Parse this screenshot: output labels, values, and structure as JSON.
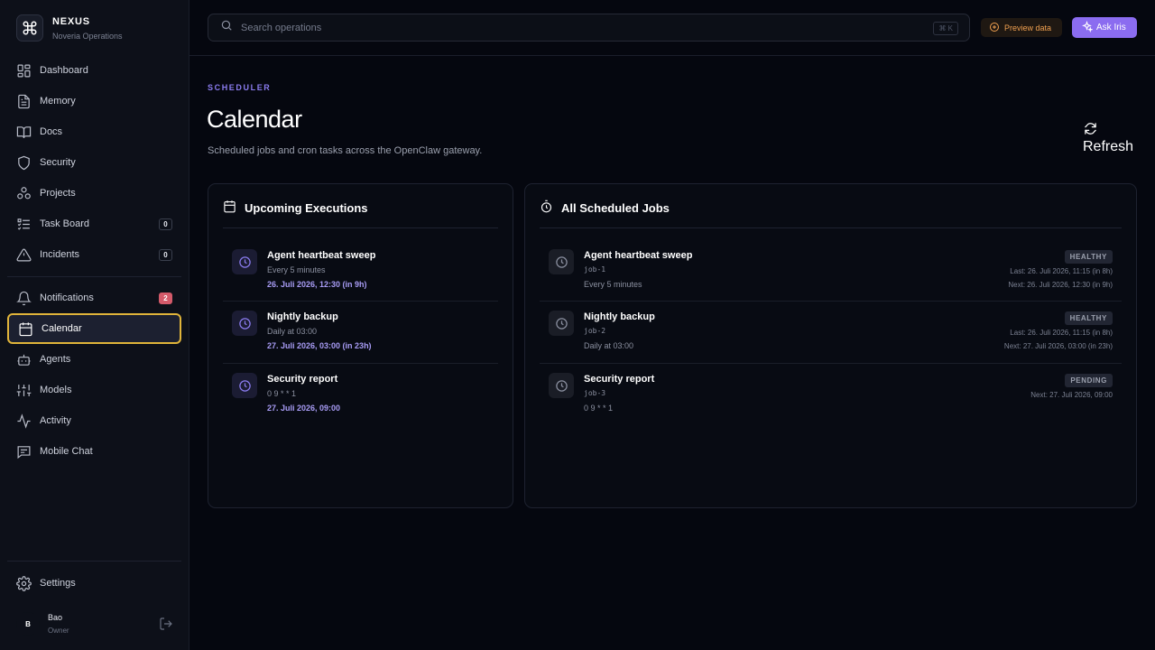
{
  "brand": {
    "name": "NEXUS",
    "subtitle": "Noveria Operations"
  },
  "sidebar": {
    "primary": [
      {
        "label": "Dashboard",
        "icon": "dashboard-icon"
      },
      {
        "label": "Memory",
        "icon": "file-icon"
      },
      {
        "label": "Docs",
        "icon": "book-icon"
      },
      {
        "label": "Security",
        "icon": "shield-icon"
      },
      {
        "label": "Projects",
        "icon": "projects-icon"
      },
      {
        "label": "Task Board",
        "icon": "task-list-icon",
        "badge": "0"
      },
      {
        "label": "Incidents",
        "icon": "warning-icon",
        "badge": "0"
      }
    ],
    "secondary": [
      {
        "label": "Notifications",
        "icon": "bell-icon",
        "badge": "2",
        "badge_color": "#d45a6a"
      },
      {
        "label": "Calendar",
        "icon": "calendar-icon",
        "active": true
      },
      {
        "label": "Agents",
        "icon": "robot-icon"
      },
      {
        "label": "Models",
        "icon": "sliders-icon"
      },
      {
        "label": "Activity",
        "icon": "activity-icon"
      },
      {
        "label": "Mobile Chat",
        "icon": "chat-icon"
      }
    ],
    "settings_label": "Settings",
    "user": {
      "initial": "B",
      "name": "Bao",
      "role": "Owner"
    }
  },
  "topbar": {
    "search_placeholder": "Search operations",
    "search_shortcut": "⌘ K",
    "preview_label": "Preview data",
    "ask_label": "Ask Iris"
  },
  "page": {
    "eyebrow": "SCHEDULER",
    "title": "Calendar",
    "subtitle": "Scheduled jobs and cron tasks across the OpenClaw gateway.",
    "refresh_label": "Refresh"
  },
  "upcoming": {
    "title": "Upcoming Executions",
    "items": [
      {
        "name": "Agent heartbeat sweep",
        "schedule": "Every 5 minutes",
        "next": "26. Juli 2026, 12:30 (in 9h)"
      },
      {
        "name": "Nightly backup",
        "schedule": "Daily at 03:00",
        "next": "27. Juli 2026, 03:00 (in 23h)"
      },
      {
        "name": "Security report",
        "schedule": "0 9 * * 1",
        "next": "27. Juli 2026, 09:00"
      }
    ]
  },
  "jobs": {
    "title": "All Scheduled Jobs",
    "items": [
      {
        "name": "Agent heartbeat sweep",
        "id": "job-1",
        "schedule": "Every 5 minutes",
        "status": "HEALTHY",
        "last": "Last: 26. Juli 2026, 11:15 (in 8h)",
        "next": "Next: 26. Juli 2026, 12:30 (in 9h)"
      },
      {
        "name": "Nightly backup",
        "id": "job-2",
        "schedule": "Daily at 03:00",
        "status": "HEALTHY",
        "last": "Last: 26. Juli 2026, 11:15 (in 8h)",
        "next": "Next: 27. Juli 2026, 03:00 (in 23h)"
      },
      {
        "name": "Security report",
        "id": "job-3",
        "schedule": "0 9 * * 1",
        "status": "PENDING",
        "next": "Next: 27. Juli 2026, 09:00"
      }
    ]
  },
  "colors": {
    "accent": "#8b6cf0",
    "active_outline": "#e0b43a",
    "preview": "#f0a050",
    "badge_red": "#d45a6a"
  }
}
